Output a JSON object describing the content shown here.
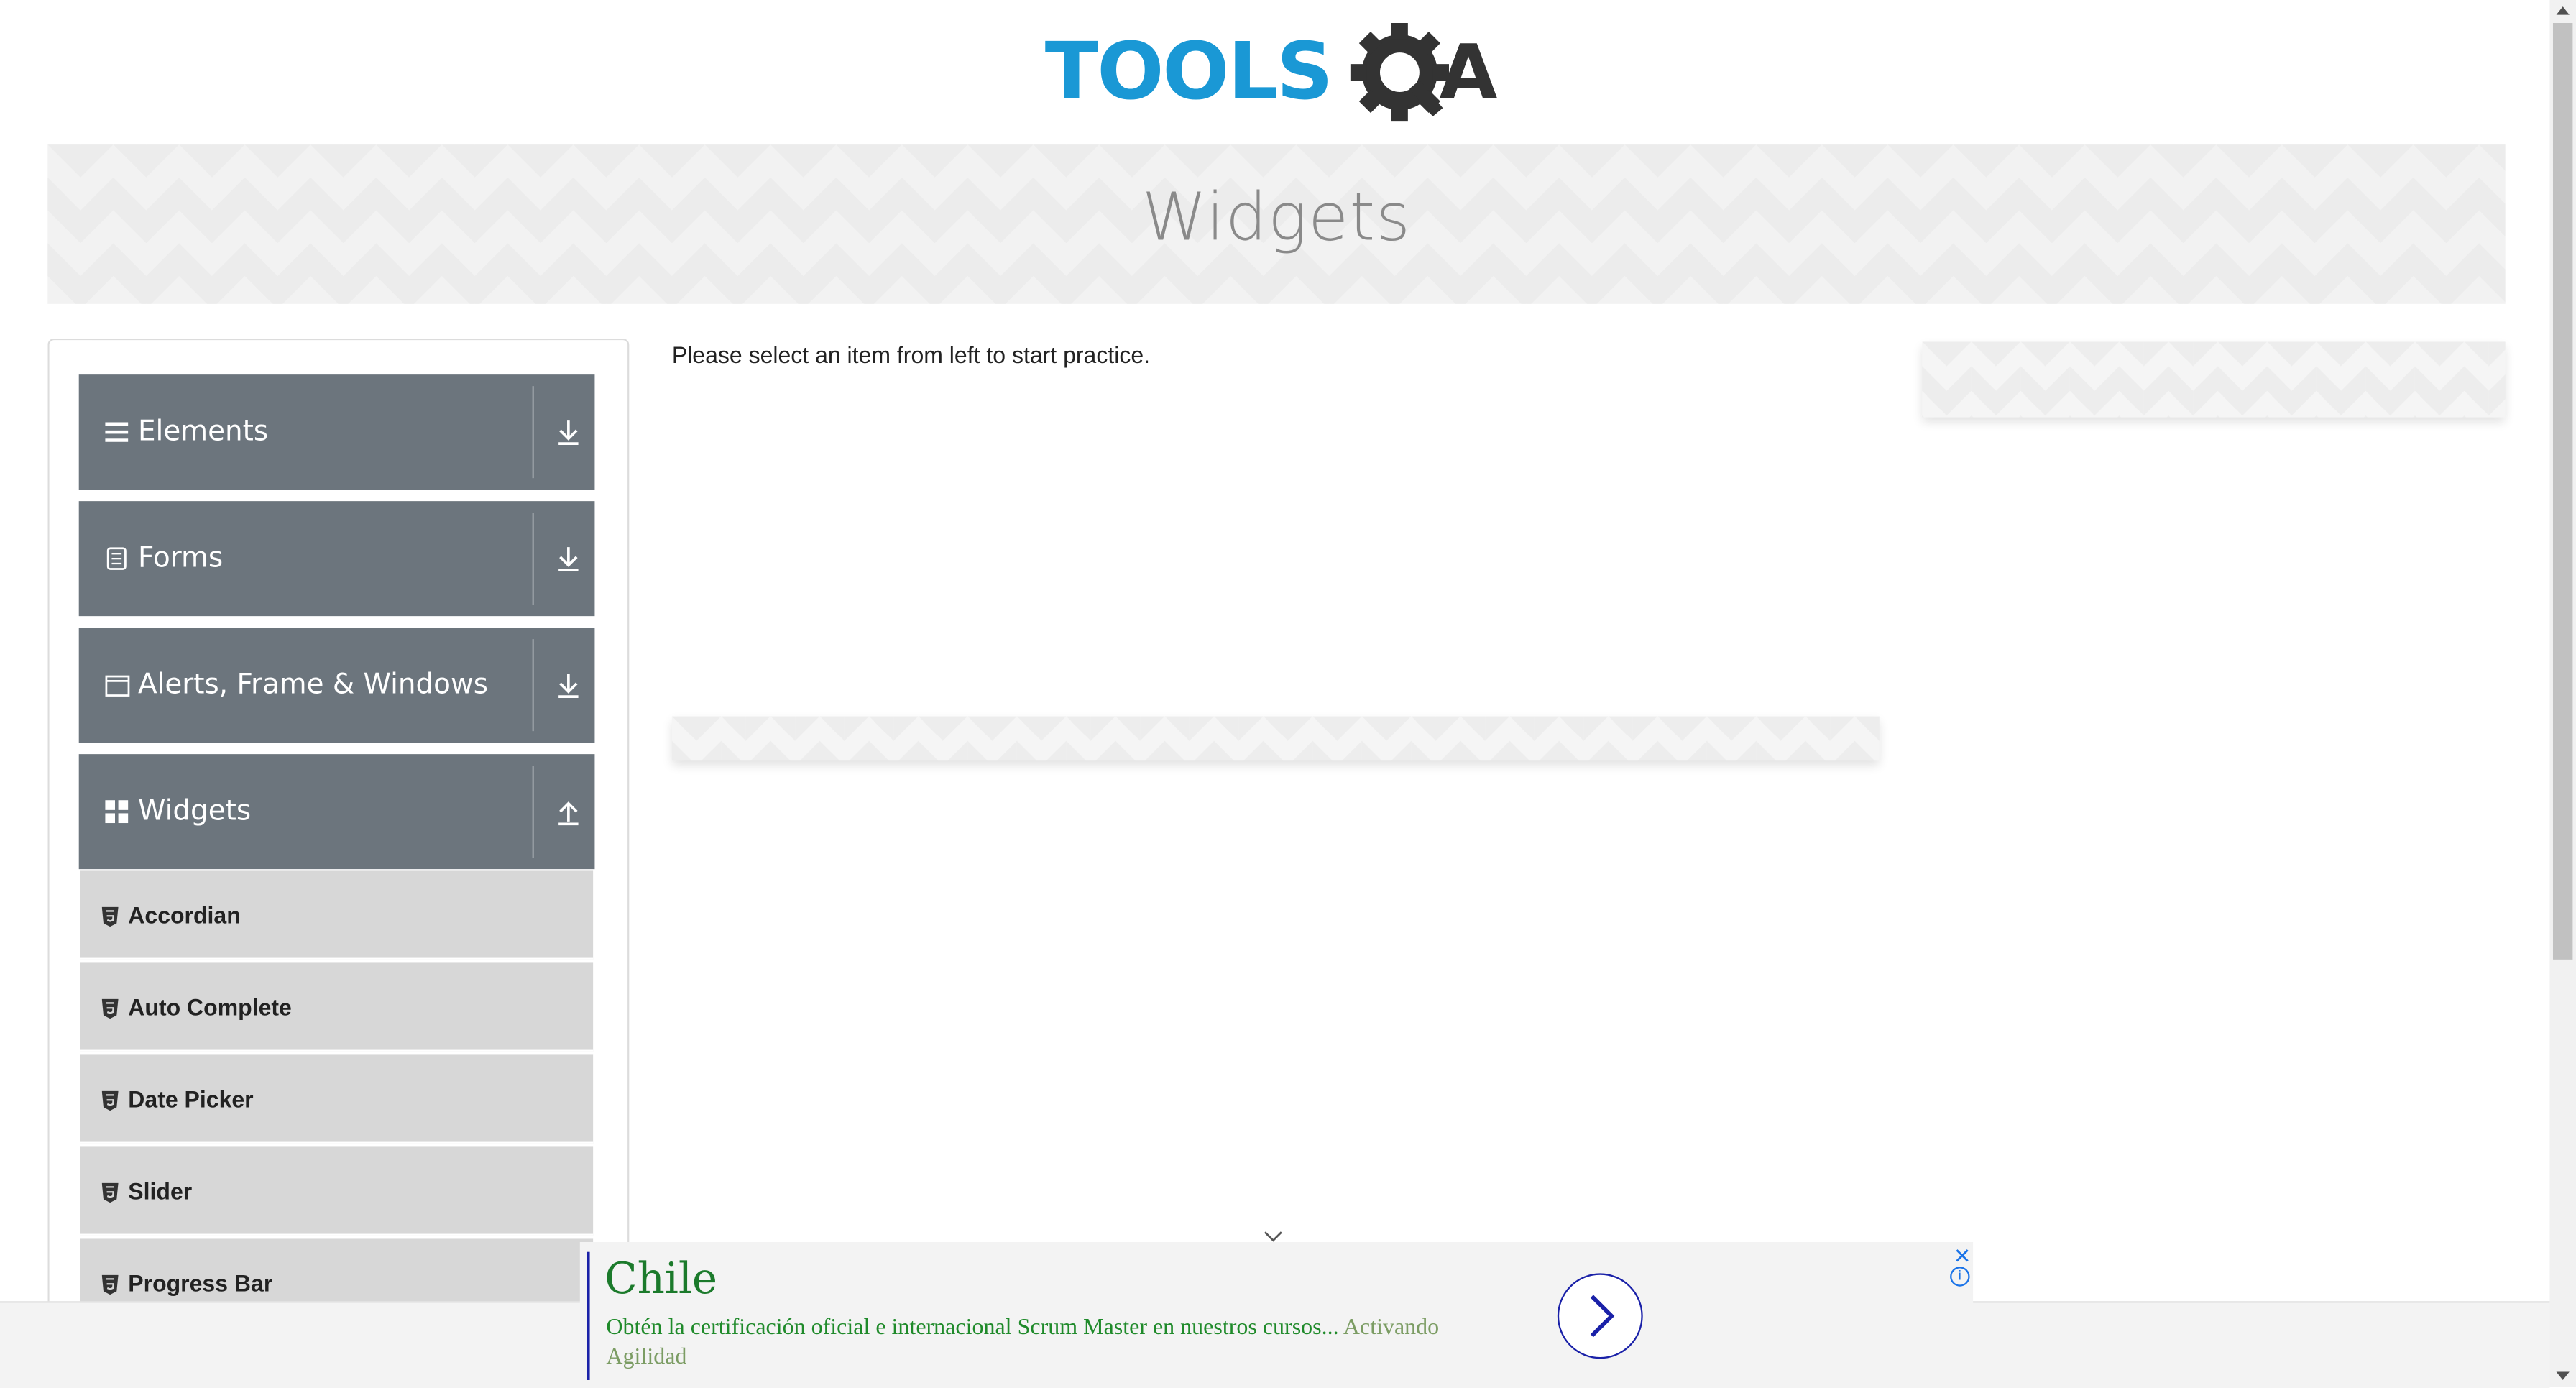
{
  "logo": {
    "text_primary": "TOOLS",
    "text_secondary": "QA",
    "color_primary": "#1a98d5",
    "color_secondary": "#333333"
  },
  "banner": {
    "title": "Widgets"
  },
  "sidebar": {
    "groups": [
      {
        "label": "Elements",
        "icon": "hamburger-icon",
        "state": "collapsed"
      },
      {
        "label": "Forms",
        "icon": "document-icon",
        "state": "collapsed"
      },
      {
        "label": "Alerts, Frame & Windows",
        "icon": "window-icon",
        "state": "collapsed"
      },
      {
        "label": "Widgets",
        "icon": "grid-icon",
        "state": "expanded"
      }
    ],
    "items": [
      {
        "label": "Accordian"
      },
      {
        "label": "Auto Complete"
      },
      {
        "label": "Date Picker"
      },
      {
        "label": "Slider"
      },
      {
        "label": "Progress Bar"
      }
    ]
  },
  "main": {
    "prompt": "Please select an item from left to start practice."
  },
  "ad": {
    "title": "Chile",
    "description": "Obtén la certificación oficial e internacional Scrum Master en nuestros cursos...",
    "advertiser": "Activando Agilidad",
    "close_label": "✕",
    "info_label": "i"
  },
  "colors": {
    "sidebar_group_bg": "#6c757d",
    "sidebar_item_bg": "#d7d7d7",
    "ad_green": "#1b7a2b",
    "ad_blue": "#1a21a8"
  }
}
